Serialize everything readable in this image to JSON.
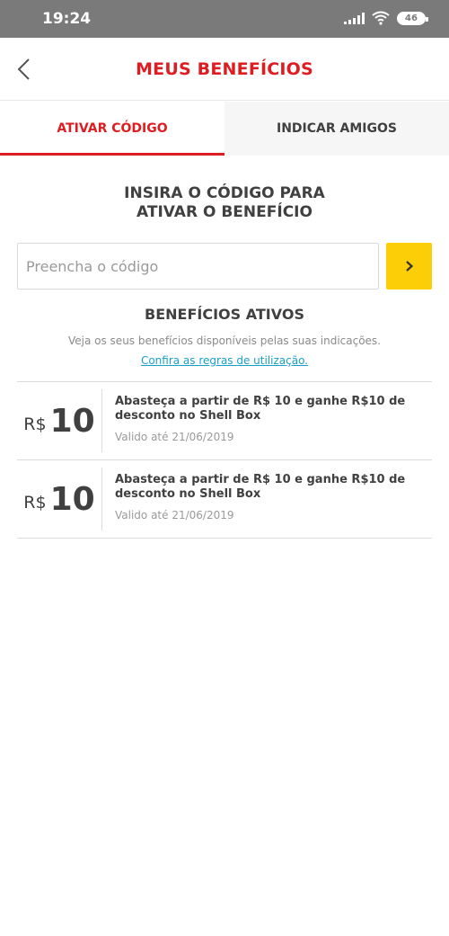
{
  "status_bar": {
    "time": "19:24",
    "battery": "46"
  },
  "header": {
    "title": "MEUS BENEFÍCIOS"
  },
  "tabs": [
    {
      "label": "ATIVAR CÓDIGO",
      "active": true
    },
    {
      "label": "INDICAR AMIGOS",
      "active": false
    }
  ],
  "activate": {
    "instruction_line1": "INSIRA O CÓDIGO PARA",
    "instruction_line2": "ATIVAR O BENEFÍCIO",
    "input_value": "",
    "input_placeholder": "Preencha o código",
    "submit_icon": "chevron-right-icon"
  },
  "active_benefits": {
    "title": "BENEFÍCIOS ATIVOS",
    "description": "Veja os seus benefícios disponíveis pelas suas indicações.",
    "rules_link": "Confira as regras de utilização.",
    "items": [
      {
        "currency": "R$",
        "value": "10",
        "description": "Abasteça a partir de R$ 10 e ganhe R$10 de desconto no Shell Box",
        "validity": "Valido até 21/06/2019"
      },
      {
        "currency": "R$",
        "value": "10",
        "description": "Abasteça a partir de R$ 10 e ganhe R$10 de desconto no Shell Box",
        "validity": "Valido até 21/06/2019"
      }
    ]
  },
  "colors": {
    "brand_red": "#dd1d21",
    "brand_yellow": "#fbce07",
    "link_blue": "#1aa0c8",
    "status_bar": "#7a7a7a"
  }
}
